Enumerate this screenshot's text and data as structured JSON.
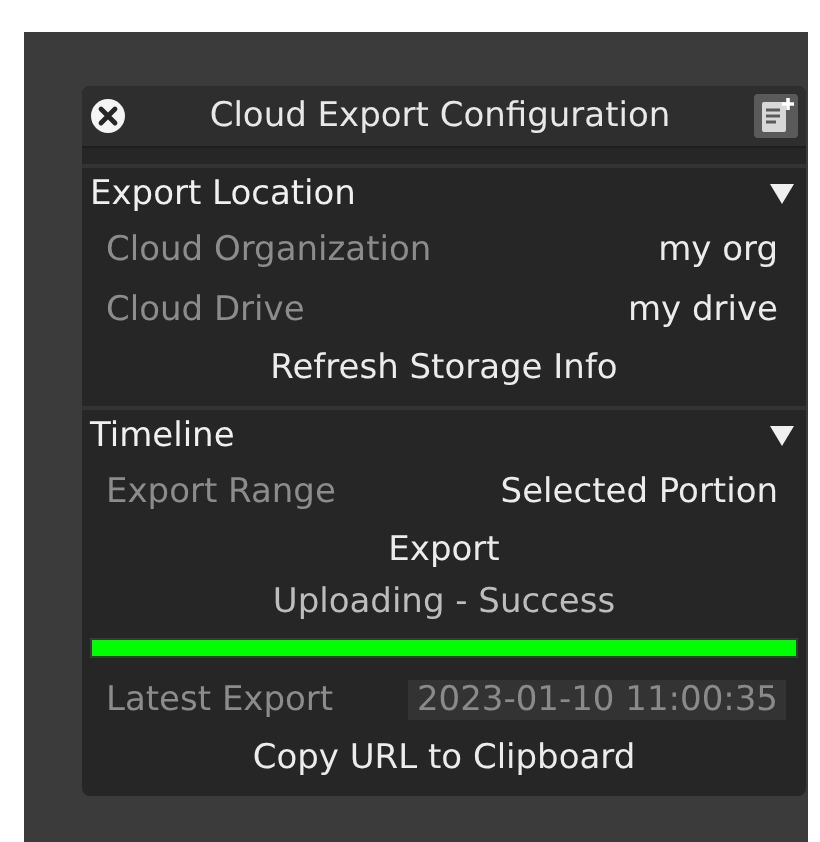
{
  "dialog": {
    "title": "Cloud Export Configuration"
  },
  "sections": [
    {
      "title": "Export Location",
      "expanded": true,
      "items": [
        {
          "kind": "field",
          "label": "Cloud Organization",
          "value": "my org"
        },
        {
          "kind": "field",
          "label": "Cloud Drive",
          "value": "my drive"
        },
        {
          "kind": "button",
          "label": "Refresh Storage Info"
        }
      ]
    },
    {
      "title": "Timeline",
      "expanded": true,
      "items": [
        {
          "kind": "field",
          "label": "Export Range",
          "value": "Selected Portion"
        },
        {
          "kind": "button",
          "label": "Export"
        },
        {
          "kind": "status",
          "text": "Uploading - Success"
        },
        {
          "kind": "progress",
          "level": 1
        },
        {
          "kind": "readonly",
          "label": "Latest Export",
          "value": "2023-01-10 11:00:35"
        },
        {
          "kind": "button",
          "label": "Copy URL to Clipboard"
        }
      ]
    }
  ]
}
